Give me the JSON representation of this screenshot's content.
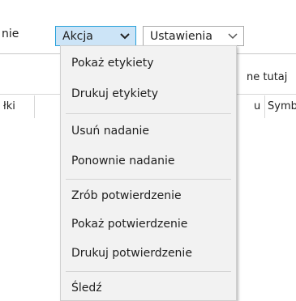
{
  "toolbar": {
    "prev_item_label": "nie",
    "action_dropdown_label": "Akcja",
    "settings_dropdown_label": "Ustawienia"
  },
  "grid": {
    "hint_text": "ne tutaj",
    "col_left_label": "łki",
    "col_right_label_1": "u",
    "col_right_label_2": "Symb"
  },
  "menu": {
    "items": [
      {
        "label": "Pokaż etykiety"
      },
      {
        "label": "Drukuj etykiety"
      },
      {
        "label": "Usuń nadanie"
      },
      {
        "label": "Ponownie nadanie"
      },
      {
        "label": "Zrób potwierdzenie"
      },
      {
        "label": "Pokaż potwierdzenie"
      },
      {
        "label": "Drukuj potwierdzenie"
      },
      {
        "label": "Śledź"
      }
    ]
  },
  "icons": {
    "action_chevron": "chevron-down-icon",
    "settings_chevron": "chevron-down-icon"
  },
  "colors": {
    "active_dropdown_bg": "#cce4f7",
    "active_dropdown_border": "#26a0da",
    "menu_bg": "#f2f2f2"
  }
}
